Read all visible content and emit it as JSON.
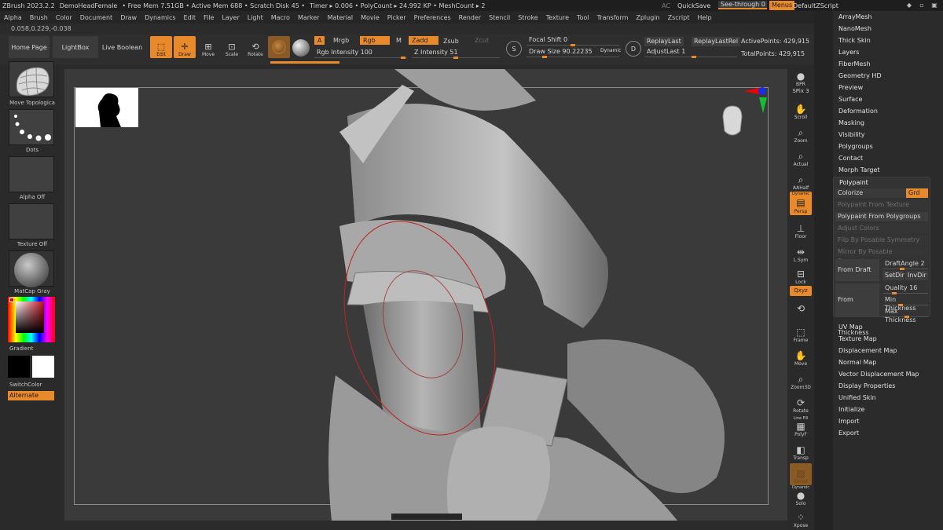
{
  "titlebar": {
    "items": [
      "ZBrush 2023.2.2",
      "DemoHeadFemale",
      "• Free Mem 7.51GB • Active Mem 688 • Scratch Disk 45 •",
      "Timer ▸ 0.006 • PolyCount ▸ 24.992 KP • MeshCount ▸ 2"
    ],
    "ac": "AC",
    "quicksave": "QuickSave",
    "see_through": "See-through  0",
    "menus": "Menus",
    "script": "DefaultZScript",
    "ctl_min": "◆",
    "ctl_max": "▫",
    "ctl_close": "▣"
  },
  "menubar": [
    "Alpha",
    "Brush",
    "Color",
    "Document",
    "Draw",
    "Dynamics",
    "Edit",
    "File",
    "Layer",
    "Light",
    "Macro",
    "Marker",
    "Material",
    "Movie",
    "Picker",
    "Preferences",
    "Render",
    "Stencil",
    "Stroke",
    "Texture",
    "Tool",
    "Transform",
    "Zplugin",
    "Zscript",
    "Help"
  ],
  "coords": "0.058,0.229,-0.038",
  "toolbar": {
    "home": "Home Page",
    "lightbox": "LightBox",
    "live_boolean": "Live Boolean",
    "edit": "Edit",
    "draw": "Draw",
    "move": "Move",
    "scale": "Scale",
    "rotate": "Rotate",
    "a": "A",
    "mrgb": "Mrgb",
    "rgb": "Rgb",
    "m": "M",
    "zadd": "Zadd",
    "zsub": "Zsub",
    "zcut": "Zcut",
    "rgb_intensity": "Rgb Intensity 100",
    "z_intensity": "Z Intensity 51",
    "rgb_intensity_value": 1.0,
    "z_intensity_value": 0.51,
    "s": "S",
    "d": "D",
    "focal_shift": "Focal Shift 0",
    "draw_size": "Draw Size 90.22235",
    "dynamic": "Dynamic",
    "replay_last": "ReplayLast",
    "replay_last_rel": "ReplayLastRel",
    "adjust_last": "AdjustLast 1",
    "active_points": "ActivePoints: 429,915",
    "total_points": "TotalPoints: 429,915"
  },
  "left_shelf": {
    "brush": "Move Topologica",
    "stroke": "Dots",
    "alpha": "Alpha Off",
    "texture": "Texture Off",
    "material": "MatCap Gray",
    "gradient": "Gradient",
    "switch_color": "SwitchColor",
    "alternate": "Alternate"
  },
  "right_shelf": {
    "bpr": "BPR",
    "spix": "SPix 3",
    "scroll": "Scroll",
    "zoom": "Zoom",
    "actual": "Actual",
    "aahalf": "AAHalf",
    "dynamic": "Dynamic",
    "persp": "Persp",
    "floor": "Floor",
    "lsym": "L.Sym",
    "lock": "Lock",
    "xyz": "Qxyz",
    "frame": "Frame",
    "move": "Move",
    "zoom3d": "Zoom3D",
    "rotate": "Rotate",
    "line_fill": "Line Fill",
    "polyf": "PolyF",
    "transp": "Transp",
    "ghost": "Ghost",
    "dynamic2": "Dynamic",
    "solo": "Solo",
    "xpose": "Xpose"
  },
  "panel": {
    "top_items": [
      "ArrayMesh",
      "NanoMesh",
      "Thick Skin",
      "Layers",
      "FiberMesh",
      "Geometry HD",
      "Preview",
      "Surface",
      "Deformation",
      "Masking",
      "Visibility",
      "Polygroups",
      "Contact",
      "Morph Target"
    ],
    "polypaint": {
      "title": "Polypaint",
      "colorize": "Colorize",
      "grd": "Grd",
      "from_texture": "Polypaint From Texture",
      "from_polygroups": "Polypaint From Polygroups",
      "adjust_colors": "Adjust Colors",
      "flip": "Flip By Posable Symmetry",
      "mirror": "Mirror By Posable Symmetry",
      "from_draft": "From Draft",
      "draft_angle": "DraftAngle 2",
      "setdir": "SetDir",
      "invdir": "InvDir",
      "from_thickness": "From Thickness",
      "quality": "Quality 16",
      "min_thickness": "Min Thickness",
      "max_thickness": "Max Thickness"
    },
    "bottom_items": [
      "UV Map",
      "Texture Map",
      "Displacement Map",
      "Normal Map",
      "Vector Displacement Map",
      "Display Properties",
      "Unified Skin",
      "Initialize",
      "Import",
      "Export"
    ]
  },
  "colors": {
    "accent": "#e8892b",
    "background": "#2b2b2b",
    "viewport": "#3a3a3a"
  }
}
